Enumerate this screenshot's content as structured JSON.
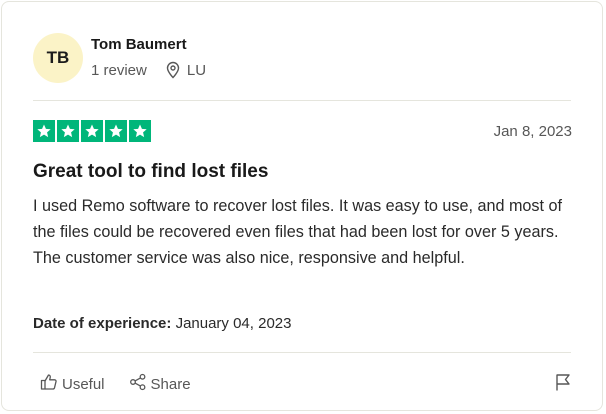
{
  "reviewer": {
    "initials": "TB",
    "name": "Tom Baumert",
    "review_count": "1 review",
    "location": "LU",
    "avatar_color": "#fbf3c7"
  },
  "review": {
    "rating": 5,
    "max_rating": 5,
    "star_color": "#00b67a",
    "date": "Jan 8, 2023",
    "title": "Great tool to find lost files",
    "body": "I used Remo software to recover lost files. It was easy to use, and most of the files could be recovered even files that had been lost for over 5 years. The customer service was also nice, responsive and helpful.",
    "experience_label": "Date of experience:",
    "experience_date": "January 04, 2023"
  },
  "actions": {
    "useful_label": "Useful",
    "share_label": "Share",
    "useful_icon": "thumbs-up-icon",
    "share_icon": "share-icon",
    "flag_icon": "flag-icon"
  }
}
